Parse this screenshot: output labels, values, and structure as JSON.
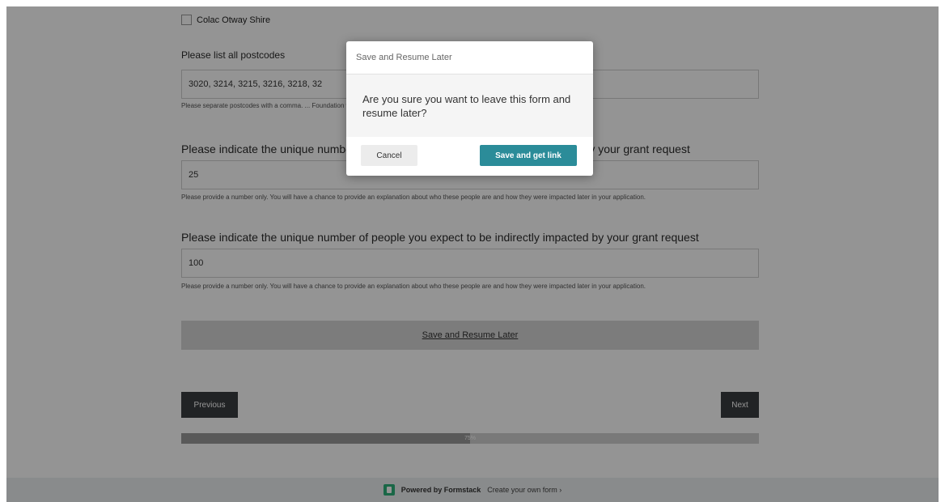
{
  "form": {
    "checkbox_label": "Colac Otway Shire",
    "postcodes_label": "Please list all postcodes",
    "postcodes_value": "3020, 3214, 3215, 3216, 3218, 32",
    "postcodes_help": "Please separate postcodes with a comma. ... Foundation website or by requesting from grants@ghotheresandos.com.au",
    "direct_label": "Please indicate the unique number of people you expect to be directly impacted by your grant request",
    "direct_value": "25",
    "direct_help": "Please provide a number only. You will have a chance to provide an explanation about who these people are and how they were impacted later in your application.",
    "indirect_label": "Please indicate the unique number of people you expect to be indirectly impacted by your grant request",
    "indirect_value": "100",
    "indirect_help": "Please provide a number only. You will have a chance to provide an explanation about who these people are and how they were impacted later in your application.",
    "save_later_link": "Save and Resume Later",
    "previous_button": "Previous",
    "next_button": "Next",
    "progress_label": "75%",
    "progress_value": 0.5
  },
  "footer": {
    "powered_by": "Powered by Formstack",
    "create_link": "Create your own form ›"
  },
  "modal": {
    "title": "Save and Resume Later",
    "message": "Are you sure you want to leave this form and resume later?",
    "cancel_button": "Cancel",
    "confirm_button": "Save and get link"
  },
  "colors": {
    "primary": "#2b8c99",
    "nav_button": "#3a3d40",
    "overlay": "rgba(0,0,0,0.42)",
    "formstack_logo": "#2db27a"
  }
}
